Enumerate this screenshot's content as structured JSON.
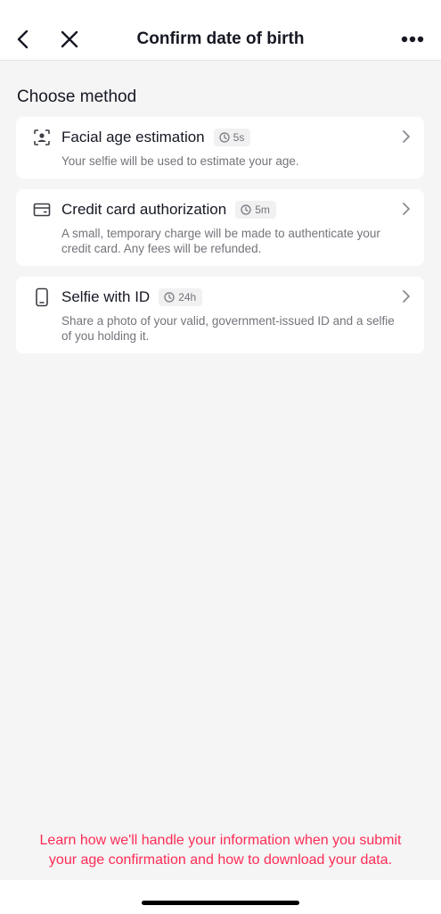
{
  "header": {
    "title": "Confirm date of birth",
    "back_icon": "chevron-left-icon",
    "close_icon": "close-icon",
    "more_icon": "more-horizontal-icon"
  },
  "section": {
    "title": "Choose method"
  },
  "methods": [
    {
      "title": "Facial age estimation",
      "time": "5s",
      "description": "Your selfie will be used to estimate your age.",
      "icon": "face-scan-icon"
    },
    {
      "title": "Credit card authorization",
      "time": "5m",
      "description": "A small, temporary charge will be made to authenticate your credit card. Any fees will be refunded.",
      "icon": "credit-card-icon"
    },
    {
      "title": "Selfie with ID",
      "time": "24h",
      "description": "Share a photo of your valid, government-issued ID and a selfie of you holding it.",
      "icon": "phone-icon"
    }
  ],
  "footer": {
    "link_text": "Learn how we'll handle your information when you submit your age confirmation and how to download your data."
  },
  "colors": {
    "accent": "#fe2c55",
    "background": "#f5f5f5",
    "card": "#ffffff",
    "secondary_text": "#73747b"
  }
}
